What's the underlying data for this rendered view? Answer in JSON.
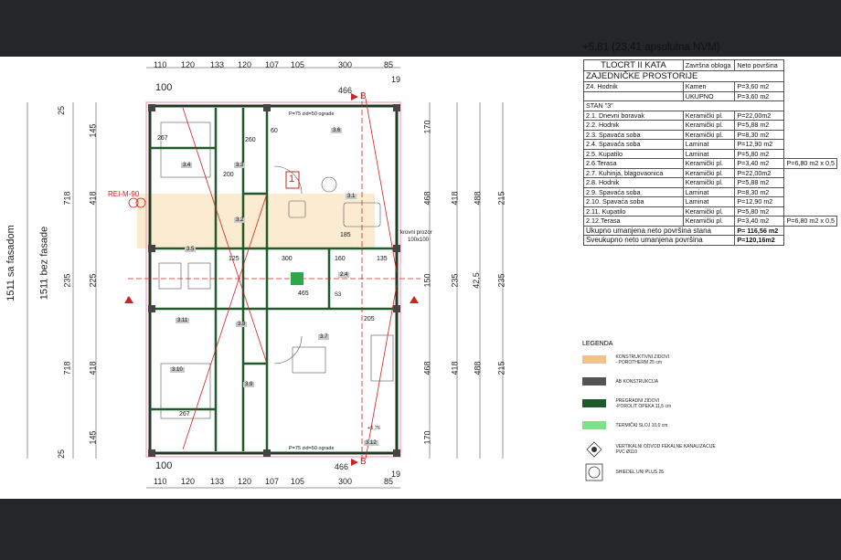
{
  "plan": {
    "top_dims": [
      "110",
      "120",
      "133",
      "120",
      "107",
      "105",
      "300",
      "85"
    ],
    "top_dims2": [
      "466",
      "19"
    ],
    "bottom_dims": [
      "110",
      "120",
      "133",
      "120",
      "107",
      "105",
      "300",
      "85"
    ],
    "bottom_dims2": [
      "466",
      "19"
    ],
    "left_dims_outer": [
      "25",
      "145",
      "25",
      "718",
      "25",
      "235",
      "25",
      "718",
      "25",
      "145",
      "25"
    ],
    "left_dims_inner": [
      "25",
      "145",
      "25",
      "418",
      "25",
      "225",
      "25",
      "418",
      "25",
      "145",
      "25"
    ],
    "left_total_facade": "1511 sa fasadom",
    "left_total_nofacade": "1511 bez fasade",
    "right_dims_a": [
      "15",
      "170",
      "468",
      "150",
      "468",
      "170",
      "15"
    ],
    "right_dims_b": [
      "25",
      "145",
      "418",
      "235",
      "418",
      "145",
      "25"
    ],
    "right_dims_c": [
      "158",
      "488",
      "42,5",
      "488",
      "158"
    ],
    "right_dims_d": [
      "25",
      "215",
      "235",
      "215",
      "25"
    ],
    "section_markers": {
      "a": "A",
      "b": "B",
      "dim_100": "100"
    },
    "fire_label": "REI-M-90",
    "rooms": [
      "3.1",
      "3.2",
      "3.3",
      "3.4",
      "3.5",
      "3.6",
      "3.7",
      "3.8",
      "3.9",
      "3.10",
      "3.11",
      "3.12",
      "2.4",
      "2.9",
      "S3"
    ],
    "notes": {
      "roof_window": "krovni prozor",
      "roof_window_size": "100x100",
      "window_note": "P=75 zid=50 ograde",
      "level_mark": "+5,76",
      "stair_1": "1"
    },
    "misc_dims": [
      "267",
      "148",
      "200",
      "370",
      "260",
      "60",
      "40",
      "418",
      "85",
      "205",
      "12",
      "225",
      "300",
      "185",
      "160",
      "135",
      "125",
      "695",
      "465",
      "100",
      "205",
      "481",
      "370",
      "40",
      "60",
      "35",
      "150",
      "205",
      "185",
      "267"
    ]
  },
  "table": {
    "level": "+5,81 (23,41 apsolutna NVM)",
    "col_floor": "TLOCRT II KATA",
    "col_finish": "Završna obloga",
    "col_area": "Neto površina",
    "common_title": "ZAJEDNIČKE PROSTORIJE",
    "common_rows": [
      {
        "name": "Z4. Hodnik",
        "finish": "Kamen",
        "area": "P=3,60 m2"
      },
      {
        "name": "",
        "finish": "UKUPNO",
        "area": "P=3,60 m2"
      }
    ],
    "flat_title": "STAN \"3\"",
    "flat_rows_a": [
      {
        "name": "2.1. Dnevni boravak",
        "finish": "Keramički pl.",
        "area": "P=22,00m2",
        "extra": ""
      },
      {
        "name": "2.2. Hodnik",
        "finish": "Keramički pl.",
        "area": "P=5,88 m2",
        "extra": ""
      },
      {
        "name": "2.3. Spavaća soba",
        "finish": "Keramički pl.",
        "area": "P=8,30 m2",
        "extra": ""
      },
      {
        "name": "2.4. Spavaća soba",
        "finish": "Laminat",
        "area": "P=12,90 m2",
        "extra": ""
      },
      {
        "name": "2.5. Kupatilo",
        "finish": "Laminat",
        "area": "P=5,80 m2",
        "extra": ""
      },
      {
        "name": "2.6.Terasa",
        "finish": "Keramički pl.",
        "area": "P=3,40 m2",
        "extra": "P=6,80 m2 x 0,5"
      }
    ],
    "flat_rows_b": [
      {
        "name": "2.7. Kuhinja, blagovaonica",
        "finish": "Keramički pl.",
        "area": "P=22,00m2",
        "extra": ""
      },
      {
        "name": "2.8. Hodnik",
        "finish": "Keramički pl.",
        "area": "P=5,88 m2",
        "extra": ""
      },
      {
        "name": "2.9. Spavaća soba",
        "finish": "Laminat",
        "area": "P=8,30 m2",
        "extra": ""
      },
      {
        "name": "2.10. Spavaća soba",
        "finish": "Laminat",
        "area": "P=12,90 m2",
        "extra": ""
      },
      {
        "name": "2.11. Kupatilo",
        "finish": "Keramički pl.",
        "area": "P=5,80 m2",
        "extra": ""
      },
      {
        "name": "2.12.Terasa",
        "finish": "Keramički pl.",
        "area": "P=3,40 m2",
        "extra": "P=6,80 m2 x 0,5"
      }
    ],
    "total_flat_label": "Ukupno umanjena neto površina stana",
    "total_flat_value": "P= 116,56 m2",
    "total_all_label": "Sveukupno neto umanjena površina",
    "total_all_value": "P=120,16m2"
  },
  "legend": {
    "title": "LEGENDA",
    "items": [
      {
        "color": "#f2c08c",
        "text1": "KONSTRUKTIVNI ZIDOVI",
        "text2": "- POROTHERM 25 cm"
      },
      {
        "color": "#555555",
        "text1": "AB KONSTRUKCIJA",
        "text2": ""
      },
      {
        "color": "#1f5a2a",
        "text1": "PREGRADNI ZIDOVI",
        "text2": "-POROLIT OPEKA 11,5 cm"
      },
      {
        "color": "#7ee08a",
        "text1": "TERMIČKI SLOJ 10,0 cm",
        "text2": ""
      }
    ],
    "symbol1_text1": "VERTIKALNI ODVOD FEKALNE KANALIZACIJE",
    "symbol1_text2": "PVC Ø110",
    "symbol2_text": "SHIEDEL UNI PLUS 25"
  }
}
